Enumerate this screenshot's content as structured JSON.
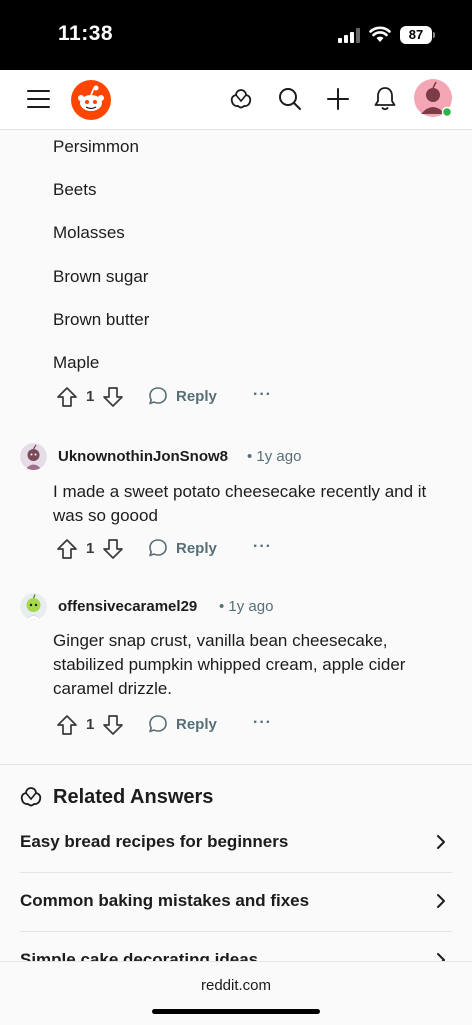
{
  "status": {
    "time": "11:38",
    "battery": "87"
  },
  "list_items": [
    "Persimmon",
    "Beets",
    "Molasses",
    "Brown sugar",
    "Brown butter",
    "Maple"
  ],
  "first_actions": {
    "votes": "1",
    "reply": "Reply",
    "more": "···"
  },
  "comments": [
    {
      "username": "UknownothinJonSnow8",
      "age": "• 1y ago",
      "body": "I made a sweet potato cheesecake recently and it was so goood",
      "votes": "1",
      "reply": "Reply",
      "more": "···"
    },
    {
      "username": "offensivecaramel29",
      "age": "• 1y ago",
      "body": "Ginger snap crust, vanilla bean cheesecake, stabilized pumpkin whipped cream, apple cider caramel drizzle.",
      "votes": "1",
      "reply": "Reply",
      "more": "···"
    }
  ],
  "related": {
    "title": "Related Answers",
    "items": [
      {
        "label": "Easy bread recipes for beginners"
      },
      {
        "label": "Common baking mistakes and fixes"
      },
      {
        "label": "Simple cake decorating ideas"
      }
    ]
  },
  "bottom": {
    "url": "reddit.com"
  },
  "colors": {
    "brand": "#ff4500",
    "meta": "#576f76",
    "online": "#2eb24a"
  },
  "icons": [
    "menu-icon",
    "reddit-logo-icon",
    "answers-icon",
    "search-icon",
    "plus-icon",
    "bell-icon",
    "upvote-icon",
    "downvote-icon",
    "comment-icon",
    "chevron-right-icon"
  ]
}
